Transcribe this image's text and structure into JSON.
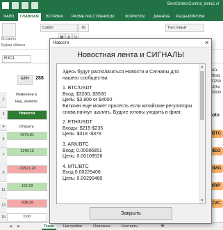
{
  "excel": {
    "window_title": "BestOrdersControl_beta2.xl",
    "ribbon_tabs": [
      "ФАЙЛ",
      "ГЛАВНАЯ",
      "ВСТАВКА",
      "РАЗМЕТКА СТРАНИЦЫ",
      "ФОРМУЛЫ",
      "ДАННЫЕ",
      "РЕЦЕНЗИРОВА"
    ],
    "active_tab": "ГЛАВНАЯ",
    "font_name": "Calibri",
    "font_size": "16",
    "number_format": "Текстовый",
    "paste_label": "Вставить",
    "clipboard_label": "Буфер обмена",
    "name_box": "R3C1",
    "cells": {
      "eth": "ETH",
      "eth_value": "288",
      "change_label_1": "Изменени в",
      "change_label_2": "Нац. валюте",
      "news_button": "Новости",
      "open_label": "Открыть",
      "values": [
        "4379,81",
        "1148,13",
        "-10521,28",
        "152,29",
        "-538,26",
        "0,00"
      ]
    },
    "right_column_fragments": [
      "aCz",
      "ZBaQ",
      "71259",
      "qQhq",
      "79039"
    ],
    "coin_labels": [
      "oto",
      "-BTC",
      "NEO",
      "OMG",
      "XRP",
      "CVC"
    ],
    "sheet_tabs": [
      "Trade",
      "Настройки",
      "Описание",
      "Контакты"
    ],
    "active_sheet": "Trade"
  },
  "dialog": {
    "title": "Новости",
    "heading": "Новостная лента и СИГНАЛЫ",
    "intro": "Здесь будут располагаться Новости и Сигналы для нашего сообщества",
    "signals": [
      {
        "title": "1. BTC/USDT",
        "entry": "Вход: $3200, $3500",
        "target": "Цель: $3,800 or $4000",
        "note": "Биткоин еще может просесть если китайские регуляторы снова  начнут шалить. Будьте готовы уходить в фиат."
      },
      {
        "title": "2. ETH/USDT",
        "entry": "Входы: $215-$235",
        "target": "Цель: $318 -$378",
        "note": ""
      },
      {
        "title": "3. ARK/BTC",
        "entry": "Вход: 0.00086851",
        "target": "Цель: 0.00108526",
        "note": ""
      },
      {
        "title": "4. MTL/BTC",
        "entry": "Вход 0.00229408",
        "target": "Цель: 0.00290460",
        "note": ""
      }
    ],
    "close_label": "Закрыть"
  },
  "colors": {
    "excel_green": "#217346",
    "positive_cell": "#b8e0b1",
    "negative_cell": "#f4a7a7"
  }
}
